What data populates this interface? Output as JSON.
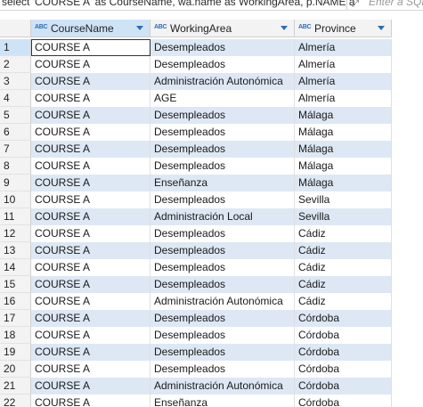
{
  "sql_bar": {
    "query_text": "select 'COURSE A' as CourseName, wa.name as WorkingArea, p.NAME a",
    "expand_icon": "expand-arrows-icon",
    "filter_placeholder": "Enter a SQL"
  },
  "columns": [
    {
      "label": "CourseName",
      "type_badge": "ABC",
      "sorted": true
    },
    {
      "label": "WorkingArea",
      "type_badge": "ABC",
      "sorted": false
    },
    {
      "label": "Province",
      "type_badge": "ABC",
      "sorted": false
    }
  ],
  "rows": [
    {
      "num": "1",
      "course": "COURSE A",
      "area": "Desempleados",
      "province": "Almería"
    },
    {
      "num": "2",
      "course": "COURSE A",
      "area": "Desempleados",
      "province": "Almería"
    },
    {
      "num": "3",
      "course": "COURSE A",
      "area": "Administración Autonómica",
      "province": "Almería"
    },
    {
      "num": "4",
      "course": "COURSE A",
      "area": "AGE",
      "province": "Almería"
    },
    {
      "num": "5",
      "course": "COURSE A",
      "area": "Desempleados",
      "province": "Málaga"
    },
    {
      "num": "6",
      "course": "COURSE A",
      "area": "Desempleados",
      "province": "Málaga"
    },
    {
      "num": "7",
      "course": "COURSE A",
      "area": "Desempleados",
      "province": "Málaga"
    },
    {
      "num": "8",
      "course": "COURSE A",
      "area": "Desempleados",
      "province": "Málaga"
    },
    {
      "num": "9",
      "course": "COURSE A",
      "area": "Enseñanza",
      "province": "Málaga"
    },
    {
      "num": "10",
      "course": "COURSE A",
      "area": "Desempleados",
      "province": "Sevilla"
    },
    {
      "num": "11",
      "course": "COURSE A",
      "area": "Administración Local",
      "province": "Sevilla"
    },
    {
      "num": "12",
      "course": "COURSE A",
      "area": "Desempleados",
      "province": "Cádiz"
    },
    {
      "num": "13",
      "course": "COURSE A",
      "area": "Desempleados",
      "province": "Cádiz"
    },
    {
      "num": "14",
      "course": "COURSE A",
      "area": "Desempleados",
      "province": "Cádiz"
    },
    {
      "num": "15",
      "course": "COURSE A",
      "area": "Desempleados",
      "province": "Cádiz"
    },
    {
      "num": "16",
      "course": "COURSE A",
      "area": "Administración Autonómica",
      "province": "Cádiz"
    },
    {
      "num": "17",
      "course": "COURSE A",
      "area": "Desempleados",
      "province": "Córdoba"
    },
    {
      "num": "18",
      "course": "COURSE A",
      "area": "Desempleados",
      "province": "Córdoba"
    },
    {
      "num": "19",
      "course": "COURSE A",
      "area": "Desempleados",
      "province": "Córdoba"
    },
    {
      "num": "20",
      "course": "COURSE A",
      "area": "Desempleados",
      "province": "Córdoba"
    },
    {
      "num": "21",
      "course": "COURSE A",
      "area": "Administración Autonómica",
      "province": "Córdoba"
    },
    {
      "num": "22",
      "course": "COURSE A",
      "area": "Enseñanza",
      "province": "Córdoba"
    }
  ],
  "colors": {
    "accent": "#2a6db4",
    "stripe": "#dde8f4",
    "header_active": "#cfe3f6"
  }
}
